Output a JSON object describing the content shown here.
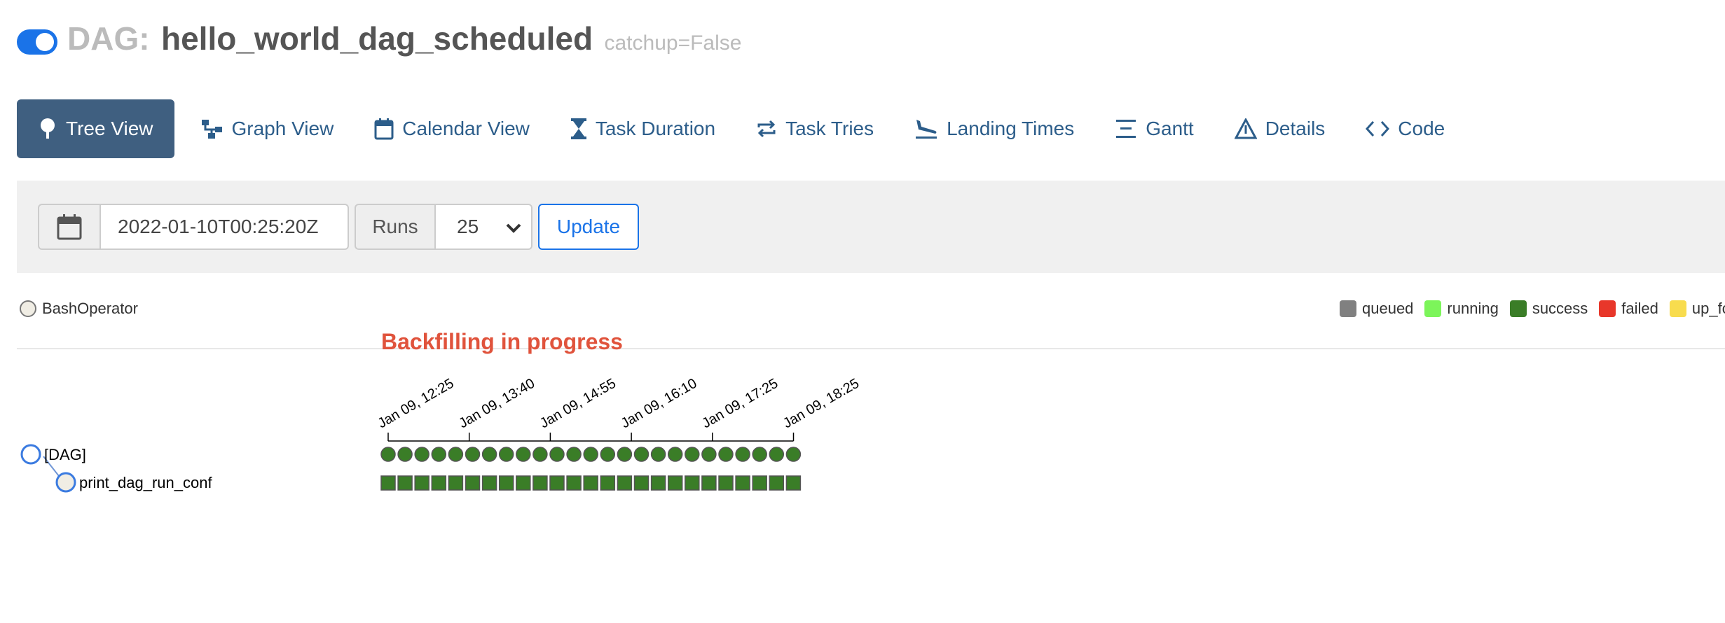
{
  "header": {
    "toggle_on": true,
    "prefix": "DAG:",
    "dag_name": "hello_world_dag_scheduled",
    "subtitle": "catchup=False"
  },
  "nav": [
    {
      "label": "Tree View",
      "icon": "tree-icon",
      "active": true
    },
    {
      "label": "Graph View",
      "icon": "graph-icon",
      "active": false
    },
    {
      "label": "Calendar View",
      "icon": "calendar-icon",
      "active": false
    },
    {
      "label": "Task Duration",
      "icon": "hourglass-icon",
      "active": false
    },
    {
      "label": "Task Tries",
      "icon": "retry-icon",
      "active": false
    },
    {
      "label": "Landing Times",
      "icon": "plane-landing-icon",
      "active": false
    },
    {
      "label": "Gantt",
      "icon": "gantt-icon",
      "active": false
    },
    {
      "label": "Details",
      "icon": "warning-triangle-icon",
      "active": false
    },
    {
      "label": "Code",
      "icon": "code-icon",
      "active": false
    }
  ],
  "form": {
    "base_date": "2022-01-10T00:25:20Z",
    "runs_label": "Runs",
    "runs_value": "25",
    "update_label": "Update"
  },
  "legend": {
    "operator": "BashOperator",
    "operator_color": "#f0ede4",
    "states": [
      {
        "label": "queued",
        "color": "#808080"
      },
      {
        "label": "running",
        "color": "#7cf55a"
      },
      {
        "label": "success",
        "color": "#3a7d27"
      },
      {
        "label": "failed",
        "color": "#e8372a"
      },
      {
        "label": "up_fo",
        "color": "#f8dc4e"
      }
    ]
  },
  "banner": "Backfilling in progress",
  "tree": {
    "root_label": "[DAG]",
    "task_label": "print_dag_run_conf",
    "run_count": 25,
    "run_state": "success",
    "run_color": "#3a7d27",
    "axis_labels": [
      "Jan 09, 12:25",
      "Jan 09, 13:40",
      "Jan 09, 14:55",
      "Jan 09, 16:10",
      "Jan 09, 17:25",
      "Jan 09, 18:25"
    ]
  }
}
